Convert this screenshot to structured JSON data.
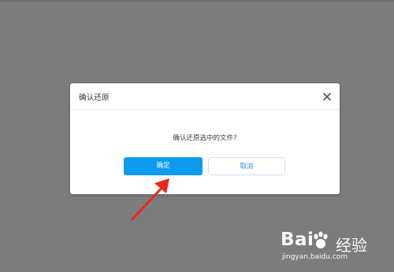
{
  "dialog": {
    "title": "确认还原",
    "message": "确认还原选中的文件?",
    "ok_label": "确定",
    "cancel_label": "取消",
    "close_icon": "close-icon"
  },
  "watermark": {
    "brand": "Bai",
    "brand_suffix": "经验",
    "url": "jingyan.baidu.com"
  },
  "colors": {
    "overlay": "#7c7c7c",
    "primary": "#0d9bf0",
    "cancel_text": "#2a8fd6",
    "arrow": "#e8281e"
  }
}
